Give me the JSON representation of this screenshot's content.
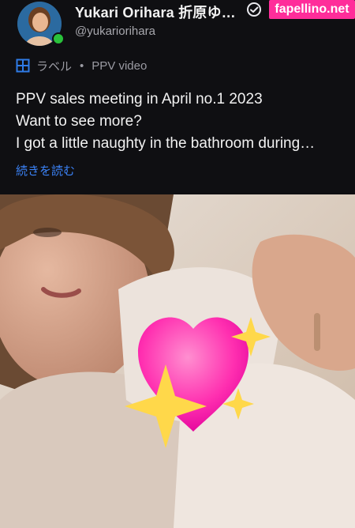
{
  "header": {
    "display_name": "Yukari Orihara 折原ゆ…",
    "handle": "@yukariorihara",
    "watermark": "fapellino.net"
  },
  "meta": {
    "label": "ラベル",
    "separator": "•",
    "type": "PPV video"
  },
  "post": {
    "lines": [
      "PPV sales meeting in April no.1 2023",
      "Want to see more?",
      "I got a little naughty in the bathroom during…"
    ],
    "read_more": "続きを読む"
  },
  "icons": {
    "verified": "verified-check-icon",
    "label": "label-grid-icon",
    "online": "online-status-dot"
  },
  "colors": {
    "background": "#0f0f12",
    "link": "#3b82f6",
    "watermark": "#ff2d9a",
    "online": "#29c23b"
  }
}
